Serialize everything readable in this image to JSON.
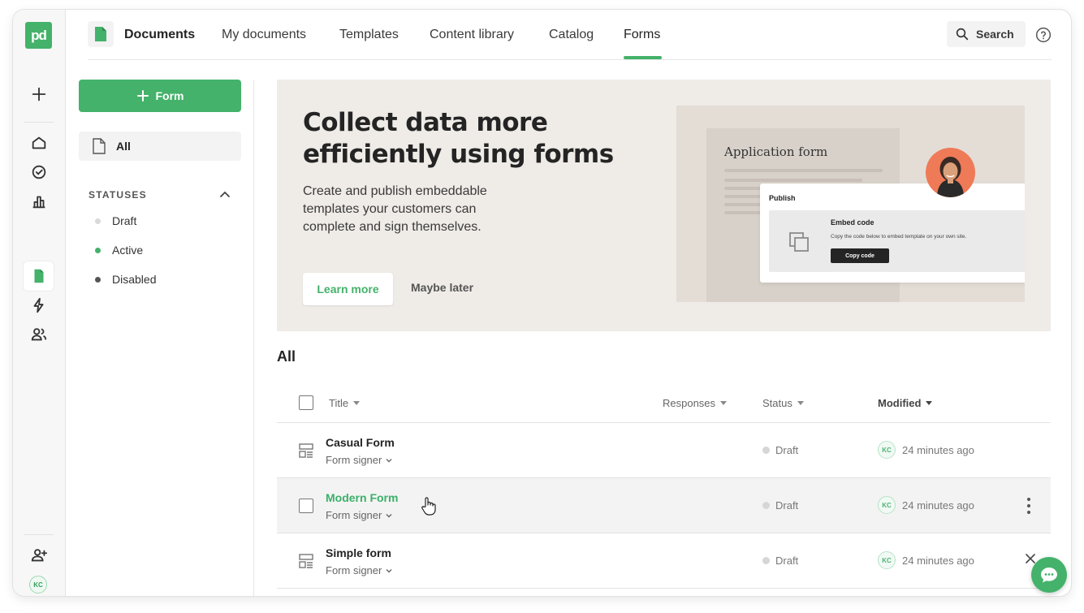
{
  "app": {
    "logo_text": "pd",
    "avatar_initials": "KC"
  },
  "topnav": {
    "brand": "Documents",
    "items": [
      "My documents",
      "Templates",
      "Content library",
      "Catalog",
      "Forms"
    ],
    "active": "Forms",
    "search_label": "Search"
  },
  "sidebar": {
    "new_button": "Form",
    "all_label": "All",
    "statuses_heading": "STATUSES",
    "statuses": [
      {
        "label": "Draft",
        "color": "#d9d9d9"
      },
      {
        "label": "Active",
        "color": "#44b26a"
      },
      {
        "label": "Disabled",
        "color": "#555555"
      }
    ]
  },
  "banner": {
    "title": "Collect data more efficiently using forms",
    "subtitle": "Create and publish embeddable templates your customers can complete and sign themselves.",
    "learn_more": "Learn more",
    "maybe_later": "Maybe later",
    "illustration": {
      "paper_title": "Application form",
      "publish_label": "Publish",
      "embed_title": "Embed code",
      "embed_desc": "Copy the code below to embed template on your own site.",
      "copy_button": "Copy code"
    }
  },
  "table": {
    "heading": "All",
    "columns": {
      "title": "Title",
      "responses": "Responses",
      "status": "Status",
      "modified": "Modified"
    },
    "rows": [
      {
        "title": "Casual Form",
        "role": "Form signer",
        "status": "Draft",
        "modified_by": "KC",
        "modified": "24 minutes ago"
      },
      {
        "title": "Modern Form",
        "role": "Form signer",
        "status": "Draft",
        "modified_by": "KC",
        "modified": "24 minutes ago"
      },
      {
        "title": "Simple form",
        "role": "Form signer",
        "status": "Draft",
        "modified_by": "KC",
        "modified": "24 minutes ago"
      }
    ]
  },
  "colors": {
    "brand_green": "#44b26a",
    "banner_bg": "#efebe7",
    "rail_bg": "#f7f7f7"
  }
}
